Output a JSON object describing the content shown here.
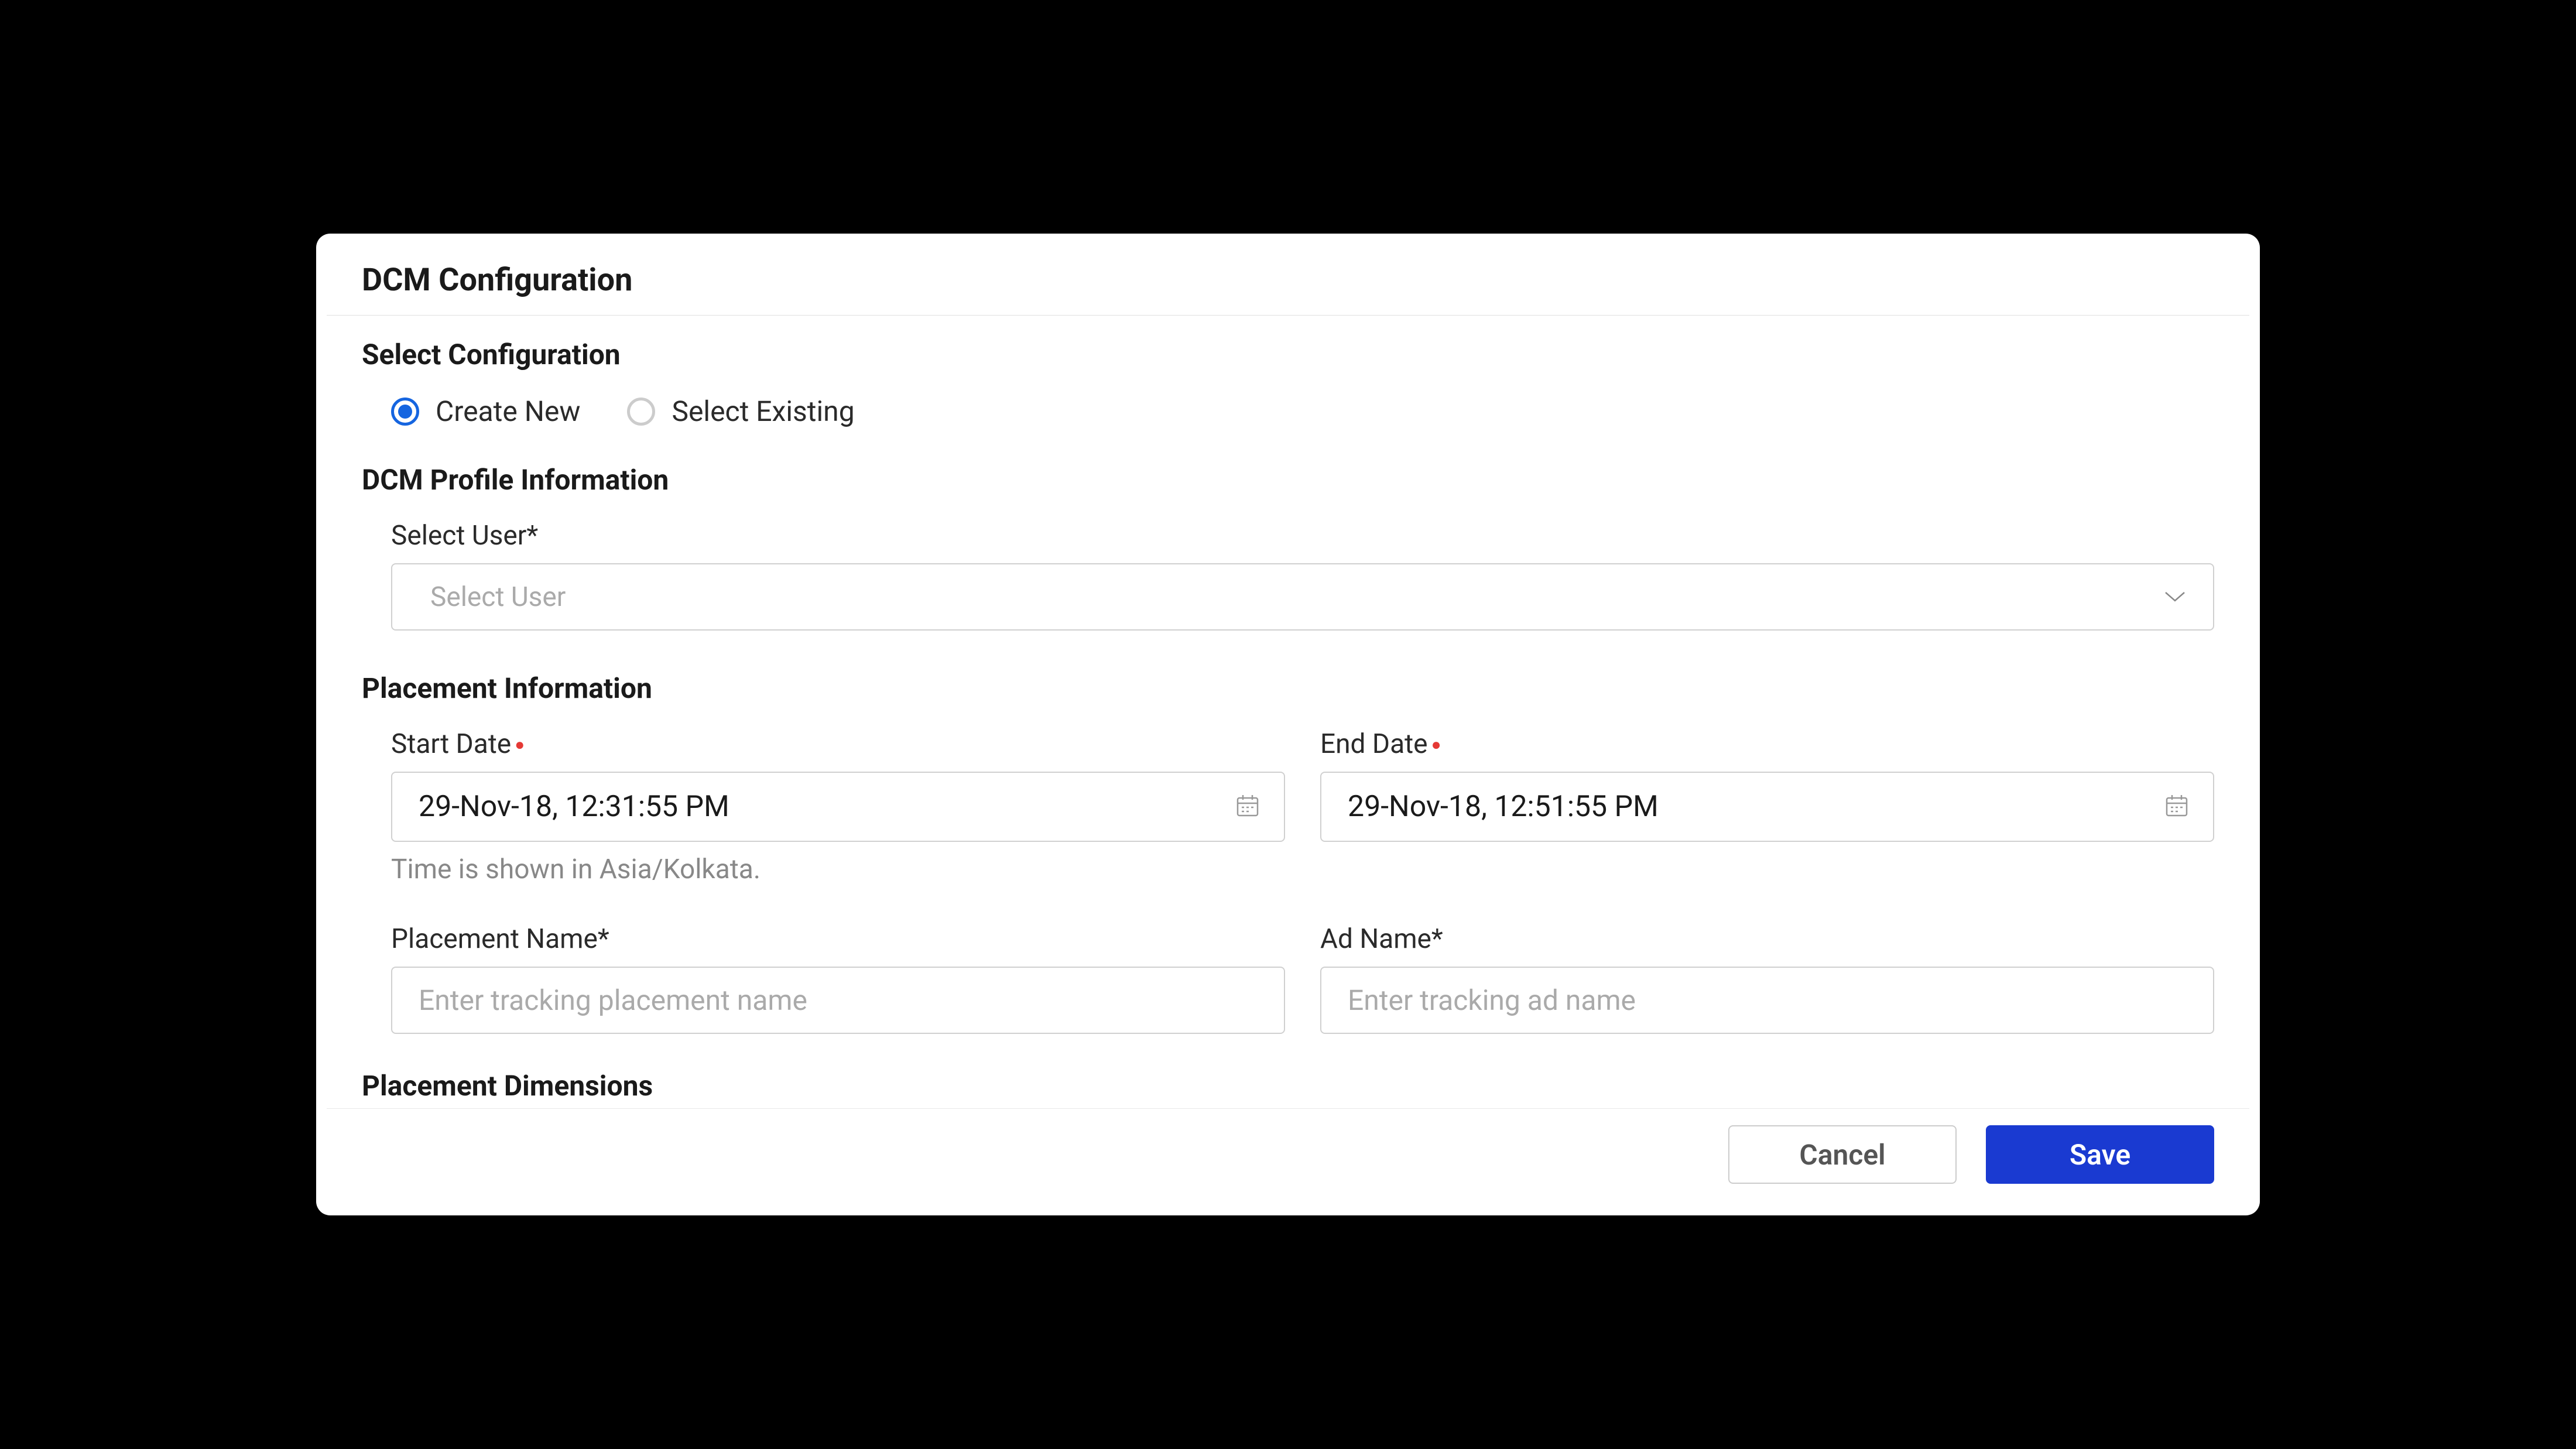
{
  "modal": {
    "title": "DCM Configuration"
  },
  "select_config": {
    "label": "Select Configuration",
    "options": {
      "create_new": "Create New",
      "select_existing": "Select Existing"
    },
    "selected": "create_new"
  },
  "profile_info": {
    "label": "DCM Profile Information",
    "select_user": {
      "label": "Select User*",
      "placeholder": "Select User"
    }
  },
  "placement_info": {
    "label": "Placement Information",
    "start_date": {
      "label": "Start Date",
      "value": "29-Nov-18, 12:31:55 PM",
      "helper": "Time is shown in Asia/Kolkata."
    },
    "end_date": {
      "label": "End Date",
      "value": "29-Nov-18, 12:51:55 PM"
    },
    "placement_name": {
      "label": "Placement Name*",
      "placeholder": "Enter tracking placement name"
    },
    "ad_name": {
      "label": "Ad Name*",
      "placeholder": "Enter tracking ad name"
    }
  },
  "dimensions": {
    "label": "Placement Dimensions"
  },
  "footer": {
    "cancel": "Cancel",
    "save": "Save"
  }
}
